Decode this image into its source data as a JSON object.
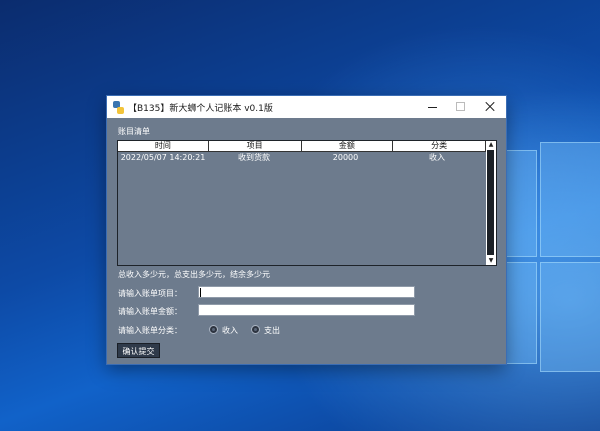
{
  "window": {
    "title": "【B135】新大蛳个人记账本 v0.1版"
  },
  "section": {
    "list_title": "账目清单"
  },
  "table": {
    "columns": [
      "时间",
      "项目",
      "金额",
      "分类"
    ],
    "rows": [
      [
        "2022/05/07 14:20:21",
        "收到货款",
        "20000",
        "收入"
      ]
    ]
  },
  "summary": "总收入多少元，总支出多少元，结余多少元",
  "form": {
    "item_label": "请输入账单项目：",
    "item_value": "",
    "amount_label": "请输入账单金额：",
    "amount_value": "",
    "category_label": "请输入账单分类：",
    "options": [
      "收入",
      "支出"
    ],
    "submit_label": "确认提交"
  }
}
